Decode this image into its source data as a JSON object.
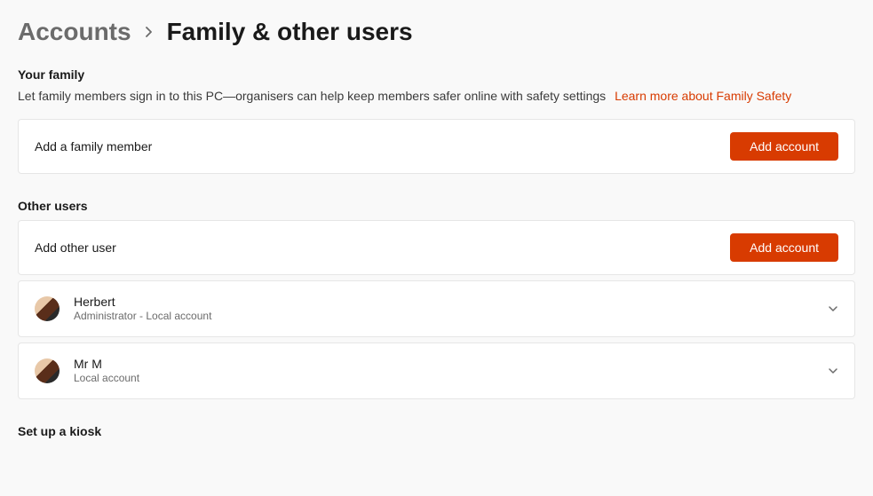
{
  "breadcrumb": {
    "root": "Accounts",
    "current": "Family & other users"
  },
  "family": {
    "heading": "Your family",
    "description": "Let family members sign in to this PC—organisers can help keep members safer online with safety settings",
    "link": "Learn more about Family Safety",
    "add_label": "Add a family member",
    "add_button": "Add account"
  },
  "other": {
    "heading": "Other users",
    "add_label": "Add other user",
    "add_button": "Add account",
    "users": [
      {
        "name": "Herbert",
        "role": "Administrator - Local account"
      },
      {
        "name": "Mr M",
        "role": "Local account"
      }
    ]
  },
  "kiosk": {
    "heading": "Set up a kiosk"
  }
}
